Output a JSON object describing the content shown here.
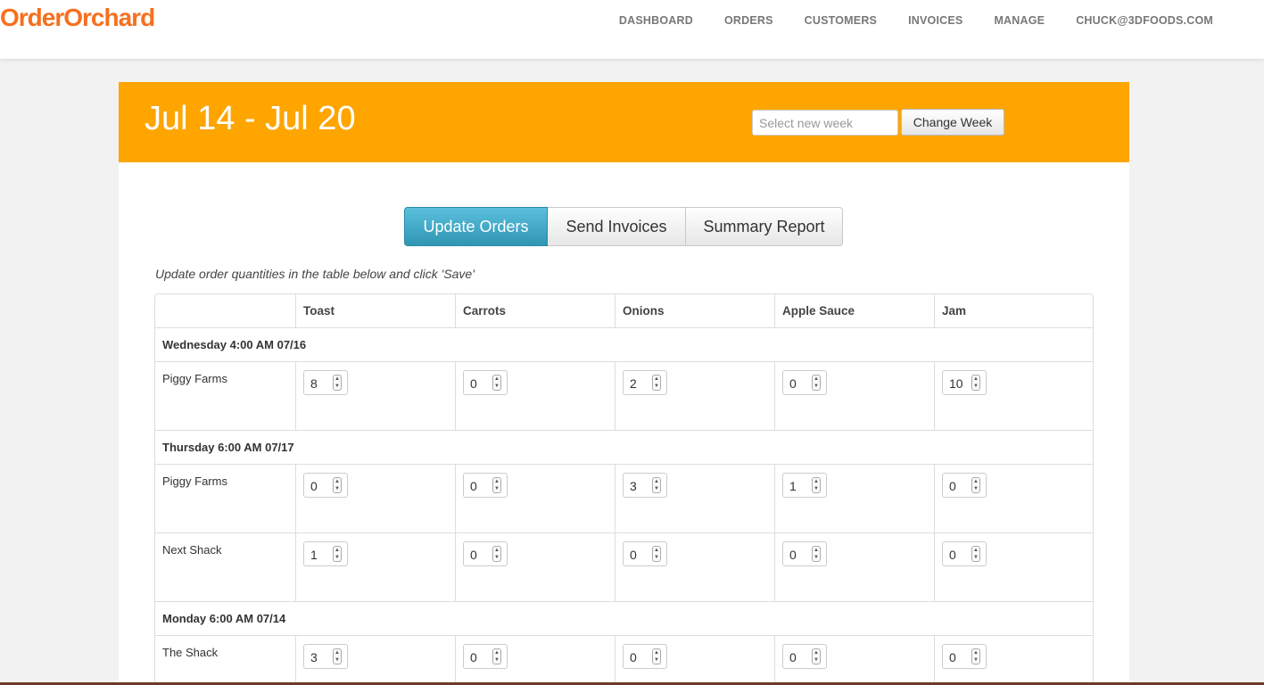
{
  "brand": "OrderOrchard",
  "nav": [
    "DASHBOARD",
    "ORDERS",
    "CUSTOMERS",
    "INVOICES",
    "MANAGE",
    "CHUCK@3DFOODS.COM"
  ],
  "week": {
    "title": "Jul 14 - Jul 20",
    "input_placeholder": "Select new week",
    "button_label": "Change Week"
  },
  "tabs": [
    "Update Orders",
    "Send Invoices",
    "Summary Report"
  ],
  "active_tab": "Update Orders",
  "hint": "Update order quantities in the table below and click 'Save'",
  "table": {
    "columns": [
      "Toast",
      "Carrots",
      "Onions",
      "Apple Sauce",
      "Jam"
    ],
    "groups": [
      {
        "label": "Wednesday 4:00 AM 07/16",
        "rows": [
          {
            "customer": "Piggy Farms",
            "quantities": [
              "8",
              "0",
              "2",
              "0",
              "10"
            ]
          }
        ]
      },
      {
        "label": "Thursday 6:00 AM 07/17",
        "rows": [
          {
            "customer": "Piggy Farms",
            "quantities": [
              "0",
              "0",
              "3",
              "1",
              "0"
            ]
          },
          {
            "customer": "Next Shack",
            "quantities": [
              "1",
              "0",
              "0",
              "0",
              "0"
            ]
          }
        ]
      },
      {
        "label": "Monday 6:00 AM 07/14",
        "rows": [
          {
            "customer": "The Shack",
            "quantities": [
              "3",
              "0",
              "0",
              "0",
              "0"
            ]
          }
        ]
      }
    ]
  },
  "colors": {
    "brand": "#f7701e",
    "header_bg": "#fea500",
    "active_tab": "#2f96b4"
  }
}
